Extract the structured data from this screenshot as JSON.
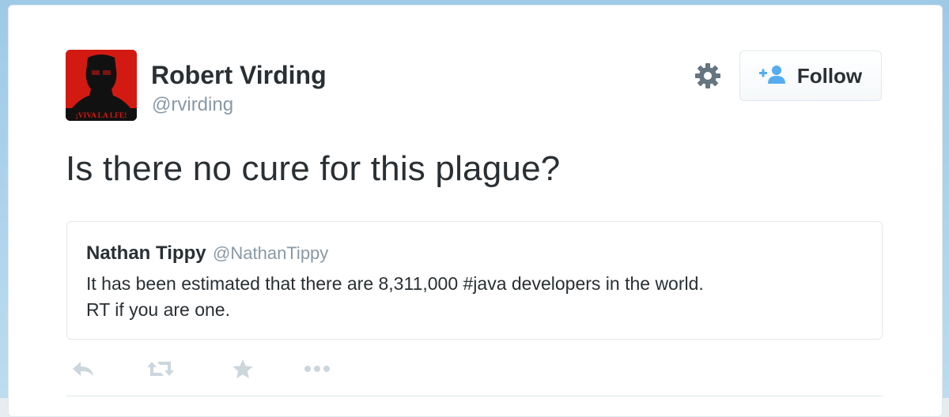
{
  "author": {
    "display_name": "Robert Virding",
    "username": "@rvirding",
    "avatar_caption": "¡VIVA LA LFE!"
  },
  "controls": {
    "settings_icon": "gear-icon",
    "follow_label": "Follow",
    "follow_icon": "add-user-icon"
  },
  "tweet": {
    "text": "Is there no cure for this plague?"
  },
  "quoted_tweet": {
    "name": "Nathan Tippy",
    "handle": "@NathanTippy",
    "lines": [
      "It has been estimated that there are 8,311,000 #java developers in the world.",
      "RT if you are one."
    ]
  },
  "actions": [
    "reply-icon",
    "retweet-icon",
    "favorite-icon",
    "more-icon"
  ],
  "colors": {
    "text": "#292f33",
    "muted": "#8899a6",
    "border": "#e1e8ed",
    "follow_icon": "#55acee",
    "avatar_bg": "#d31a12"
  }
}
